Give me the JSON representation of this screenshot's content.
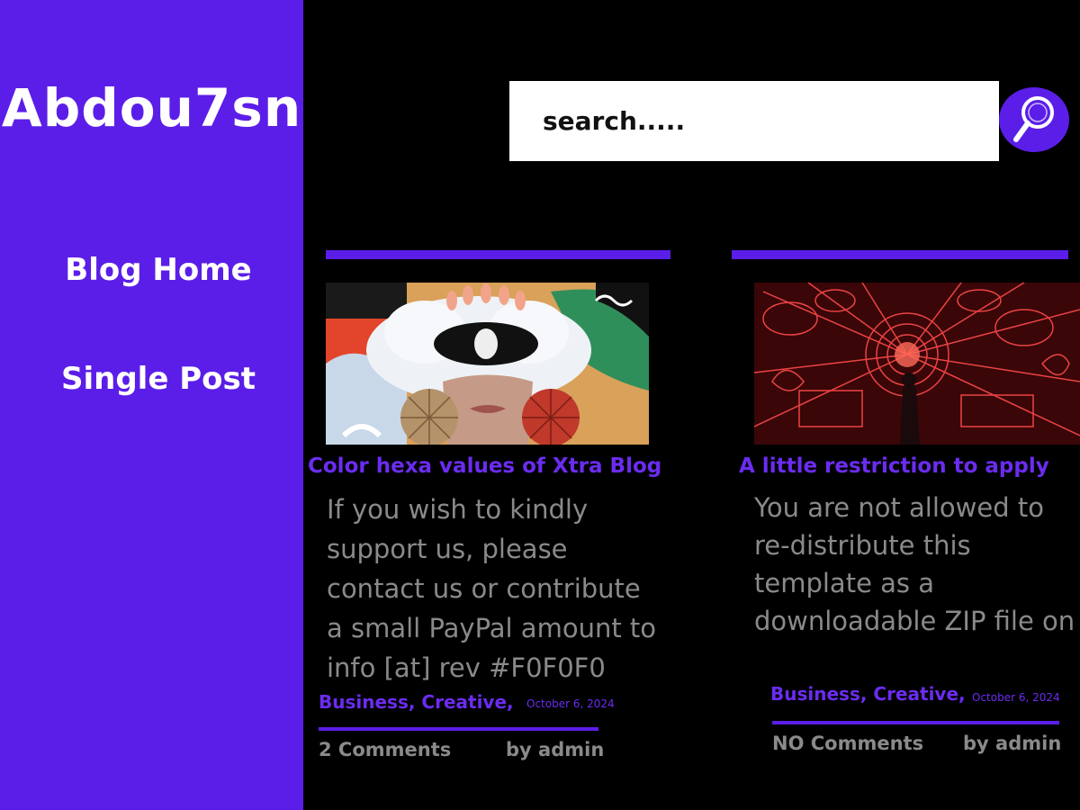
{
  "brand": "Abdou7sn",
  "nav": {
    "items": [
      {
        "label": "Blog Home"
      },
      {
        "label": "Single Post"
      }
    ]
  },
  "search": {
    "placeholder": "search.....",
    "icon": "magnifier-icon"
  },
  "colors": {
    "accent": "#5b1ee8",
    "title": "#6b2cf0",
    "text_muted": "#8a8a8a",
    "background": "#000000"
  },
  "posts": [
    {
      "title": "Color hexa values of Xtra Blog",
      "excerpt_lines": [
        "If you wish to kindly",
        "support us, please",
        "contact us or contribute",
        "a small PayPal amount to",
        "info [at] rev #F0F0F0"
      ],
      "categories": "Business, Creative,",
      "date": "October 6, 2024",
      "comments": "2 Comments",
      "author": "by admin"
    },
    {
      "title": "A little restriction to apply",
      "excerpt_lines": [
        "You are not allowed to",
        "re-distribute this",
        "template as a",
        "downloadable ZIP file on"
      ],
      "categories": "Business, Creative,",
      "date": "October 6, 2024",
      "comments": "NO Comments",
      "author": "by admin"
    }
  ]
}
